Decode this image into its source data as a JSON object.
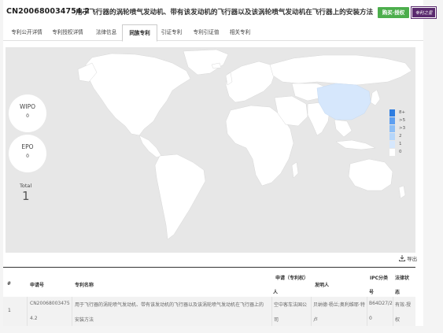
{
  "header": {
    "pub_no": "CN200680034754.2",
    "title": "用于飞行器的涡轮喷气发动机、带有该发动机的飞行器以及该涡轮喷气发动机在飞行器上的安装方法",
    "auth_button": "购买·授权",
    "logo_text": "专利之星"
  },
  "tabs": [
    "专利公开详情",
    "专利授权详情",
    "法律信息",
    "同族专利",
    "引证专利",
    "专利引证值",
    "相关专利"
  ],
  "active_tab": "同族专利",
  "map": {
    "wipo_label": "WIPO",
    "wipo_value": "0",
    "epo_label": "EPO",
    "epo_value": "0",
    "total_label": "Total",
    "total_value": "1",
    "highlighted_country": "China",
    "legend": [
      {
        "label": "8+",
        "color": "#2e7de0"
      },
      {
        "label": ">5",
        "color": "#5e9ff0"
      },
      {
        "label": ">3",
        "color": "#8ebff6"
      },
      {
        "label": "2",
        "color": "#b6d6fa"
      },
      {
        "label": "1",
        "color": "#d6e7fc"
      },
      {
        "label": "0",
        "color": "#ffffff"
      }
    ]
  },
  "export_label": "导出",
  "table": {
    "headers": {
      "num": "#",
      "app_no": "申请号",
      "name": "专利名称",
      "applicant_1": "申请（专利权）",
      "applicant_2": "人",
      "inventor": "发明人",
      "ipc_1": "IPC分类",
      "ipc_2": "号",
      "legal_1": "法律状",
      "legal_2": "态"
    },
    "row": {
      "num": "1",
      "app_no_1": "CN20068003475",
      "app_no_2": "4.2",
      "name_1": "用于飞行器的涡轮喷气发动机、带有该发动机的飞行器以及该涡轮喷气发动机在飞行器上的",
      "name_2": "安装方法",
      "applicant_1": "空中客车法国公",
      "applicant_2": "司",
      "inventor_1": "贝纳德·杨兰;奥利维耶·特",
      "inventor_2": "卢",
      "ipc_1": "B64D27/2",
      "ipc_2": "0",
      "legal_1": "有效-授",
      "legal_2": "权"
    }
  }
}
